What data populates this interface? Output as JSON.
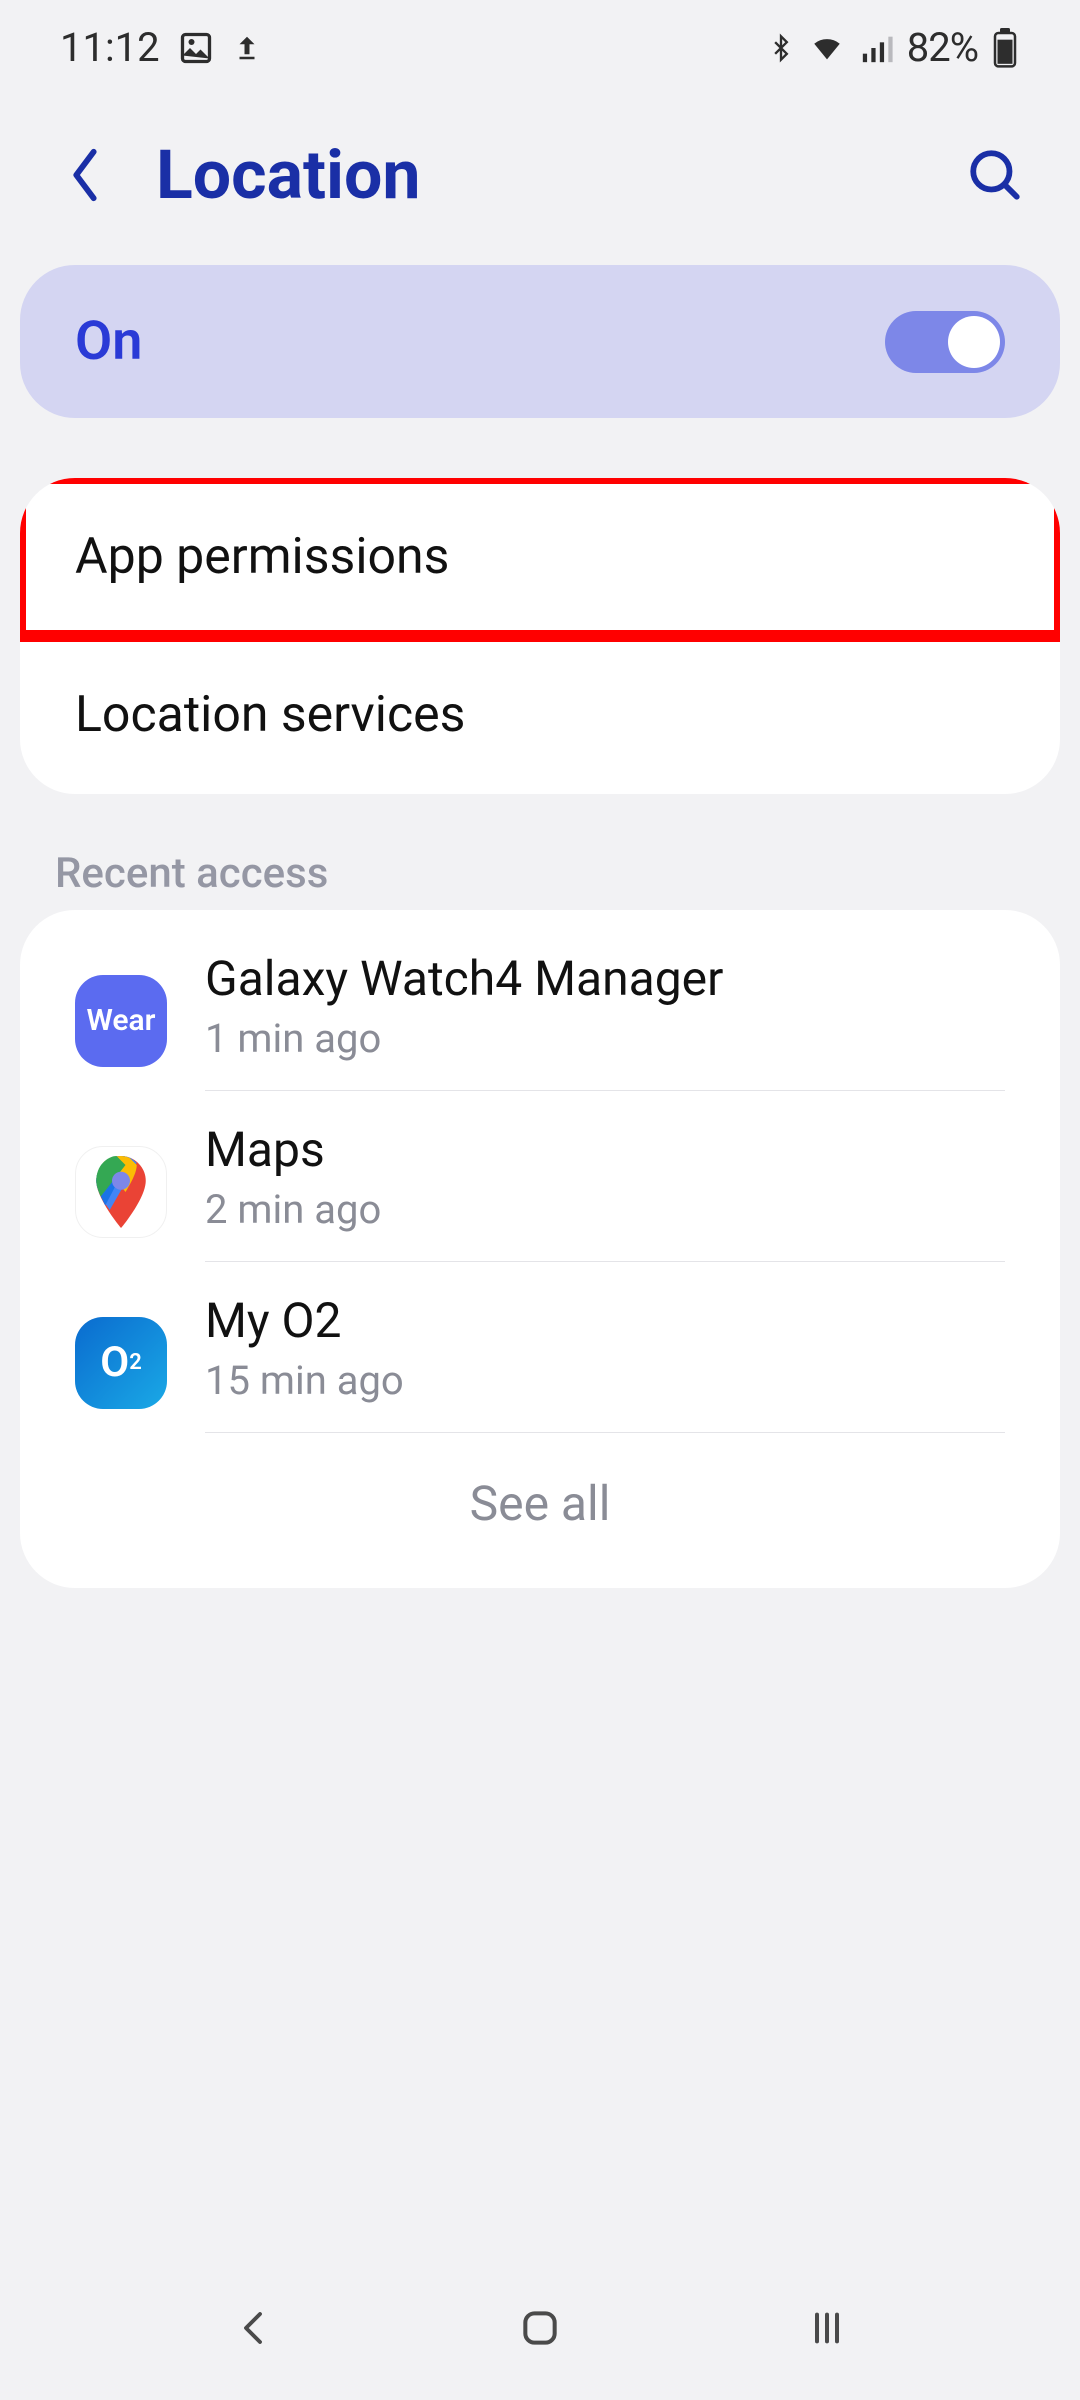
{
  "statusbar": {
    "time": "11:12",
    "battery_pct": "82%"
  },
  "header": {
    "title": "Location"
  },
  "toggle": {
    "label": "On",
    "state": true
  },
  "settings": [
    {
      "label": "App permissions",
      "highlighted": true
    },
    {
      "label": "Location services",
      "highlighted": false
    }
  ],
  "recent": {
    "section_label": "Recent access",
    "items": [
      {
        "icon": "wear",
        "icon_text": "Wear",
        "name": "Galaxy Watch4 Manager",
        "time": "1 min ago"
      },
      {
        "icon": "maps",
        "icon_text": "",
        "name": "Maps",
        "time": "2 min ago"
      },
      {
        "icon": "myo2",
        "icon_text": "O₂",
        "name": "My O2",
        "time": "15 min ago"
      }
    ],
    "see_all": "See all"
  }
}
